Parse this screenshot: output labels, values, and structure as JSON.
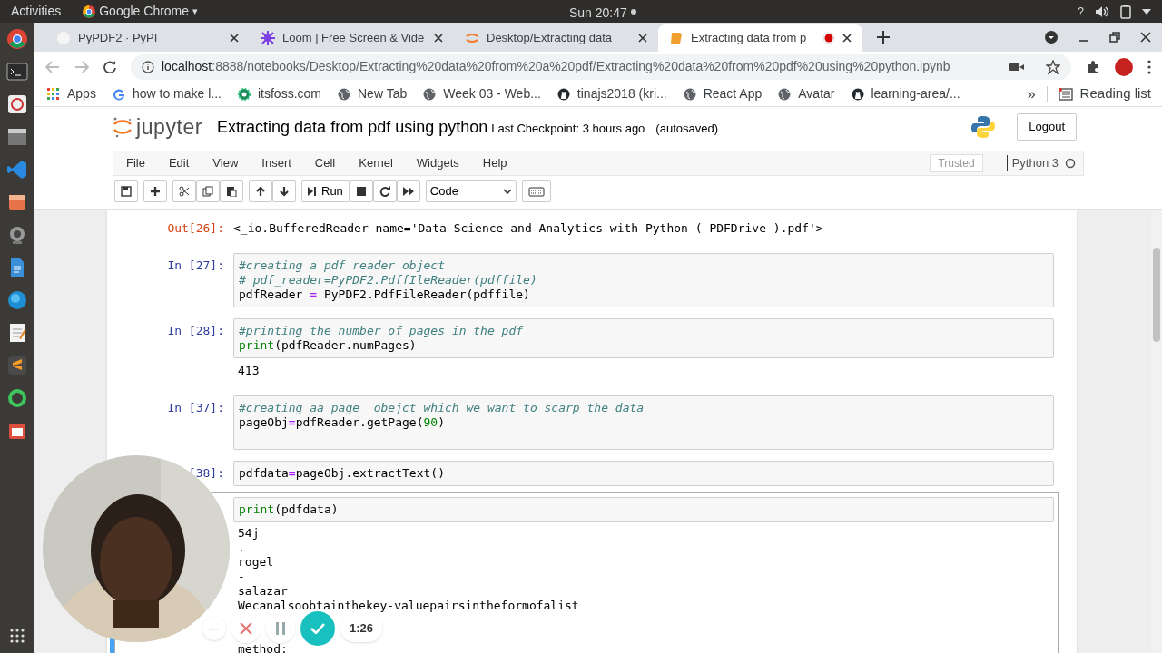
{
  "top_bar": {
    "activities": "Activities",
    "app": "Google Chrome",
    "app_caret": "▾",
    "clock": "Sun 20:47",
    "help": "?"
  },
  "tabs": [
    {
      "title": "PyPDF2 · PyPI",
      "kind": "blank",
      "selected": false,
      "recording": false
    },
    {
      "title": "Loom | Free Screen & Vide",
      "kind": "loom",
      "selected": false,
      "recording": false
    },
    {
      "title": "Desktop/Extracting data",
      "kind": "jupyter",
      "selected": false,
      "recording": false
    },
    {
      "title": "Extracting data from p",
      "kind": "notebook",
      "selected": true,
      "recording": true
    }
  ],
  "address": {
    "host": "localhost",
    "path": ":8888/notebooks/Desktop/Extracting%20data%20from%20a%20pdf/Extracting%20data%20from%20pdf%20using%20python.ipynb"
  },
  "bookmarks": [
    {
      "label": "Apps",
      "kind": "apps"
    },
    {
      "label": "how to make l...",
      "kind": "google"
    },
    {
      "label": "itsfoss.com",
      "kind": "gear"
    },
    {
      "label": "New Tab",
      "kind": "globe"
    },
    {
      "label": "Week 03 - Web...",
      "kind": "globe"
    },
    {
      "label": "tinajs2018 (kri...",
      "kind": "github"
    },
    {
      "label": "React App",
      "kind": "globe"
    },
    {
      "label": "Avatar",
      "kind": "globe"
    },
    {
      "label": "learning-area/...",
      "kind": "github"
    }
  ],
  "bookmarks_more": "»",
  "reading_list": "Reading list",
  "notebook": {
    "logo_text": "jupyter",
    "title": "Extracting data from pdf using python",
    "checkpoint": "Last Checkpoint: 3 hours ago",
    "autosaved": "(autosaved)",
    "logout": "Logout",
    "menu": [
      "File",
      "Edit",
      "View",
      "Insert",
      "Cell",
      "Kernel",
      "Widgets",
      "Help"
    ],
    "trusted": "Trusted",
    "kernel": "Python 3",
    "run": "Run",
    "cell_type": "Code"
  },
  "cells": [
    {
      "kind": "output",
      "prompt": "Out[26]:",
      "text": "<_io.BufferedReader name='Data Science and Analytics with Python ( PDFDrive ).pdf'>",
      "selected": false
    },
    {
      "kind": "code",
      "prompt": "In [27]:",
      "selected": false,
      "lines": [
        [
          {
            "kind": "comment",
            "s": "#creating a pdf reader object"
          }
        ],
        [
          {
            "kind": "comment",
            "s": "# pdf_reader=PyPDF2.PdffIleReader(pdffile)"
          }
        ],
        [
          {
            "kind": "name",
            "s": "pdfReader "
          },
          {
            "kind": "op",
            "s": "="
          },
          {
            "kind": "name",
            "s": " PyPDF2.PdfFileReader(pdffile)"
          }
        ]
      ]
    },
    {
      "kind": "code",
      "prompt": "In [28]:",
      "selected": false,
      "lines": [
        [
          {
            "kind": "comment",
            "s": "#printing the number of pages in the pdf"
          }
        ],
        [
          {
            "kind": "builtin",
            "s": "print"
          },
          {
            "kind": "name",
            "s": "(pdfReader.numPages)"
          }
        ]
      ],
      "output": [
        "413"
      ]
    },
    {
      "kind": "code",
      "prompt": "In [37]:",
      "selected": false,
      "lines": [
        [
          {
            "kind": "comment",
            "s": "#creating aa page  obejct which we want to scarp the data"
          }
        ],
        [
          {
            "kind": "name",
            "s": "pageObj"
          },
          {
            "kind": "op",
            "s": "="
          },
          {
            "kind": "name",
            "s": "pdfReader.getPage("
          },
          {
            "kind": "number",
            "s": "90"
          },
          {
            "kind": "name",
            "s": ")"
          }
        ]
      ]
    },
    {
      "kind": "code",
      "prompt": "[38]:",
      "selected": false,
      "lines": [
        [
          {
            "kind": "name",
            "s": "pdfdata"
          },
          {
            "kind": "op",
            "s": "="
          },
          {
            "kind": "name",
            "s": "pageObj.extractText()"
          }
        ]
      ]
    },
    {
      "kind": "code",
      "selected": true,
      "lines": [
        [
          {
            "kind": "builtin",
            "s": "print"
          },
          {
            "kind": "name",
            "s": "(pdfdata)"
          }
        ]
      ],
      "output": [
        "54j",
        ".",
        "rogel",
        "-",
        "salazar",
        "Wecanalsoobtainthekey-valuepairsintheformofalist",
        "method:"
      ]
    }
  ],
  "recorder": {
    "more": "···",
    "timer": "1:26"
  }
}
